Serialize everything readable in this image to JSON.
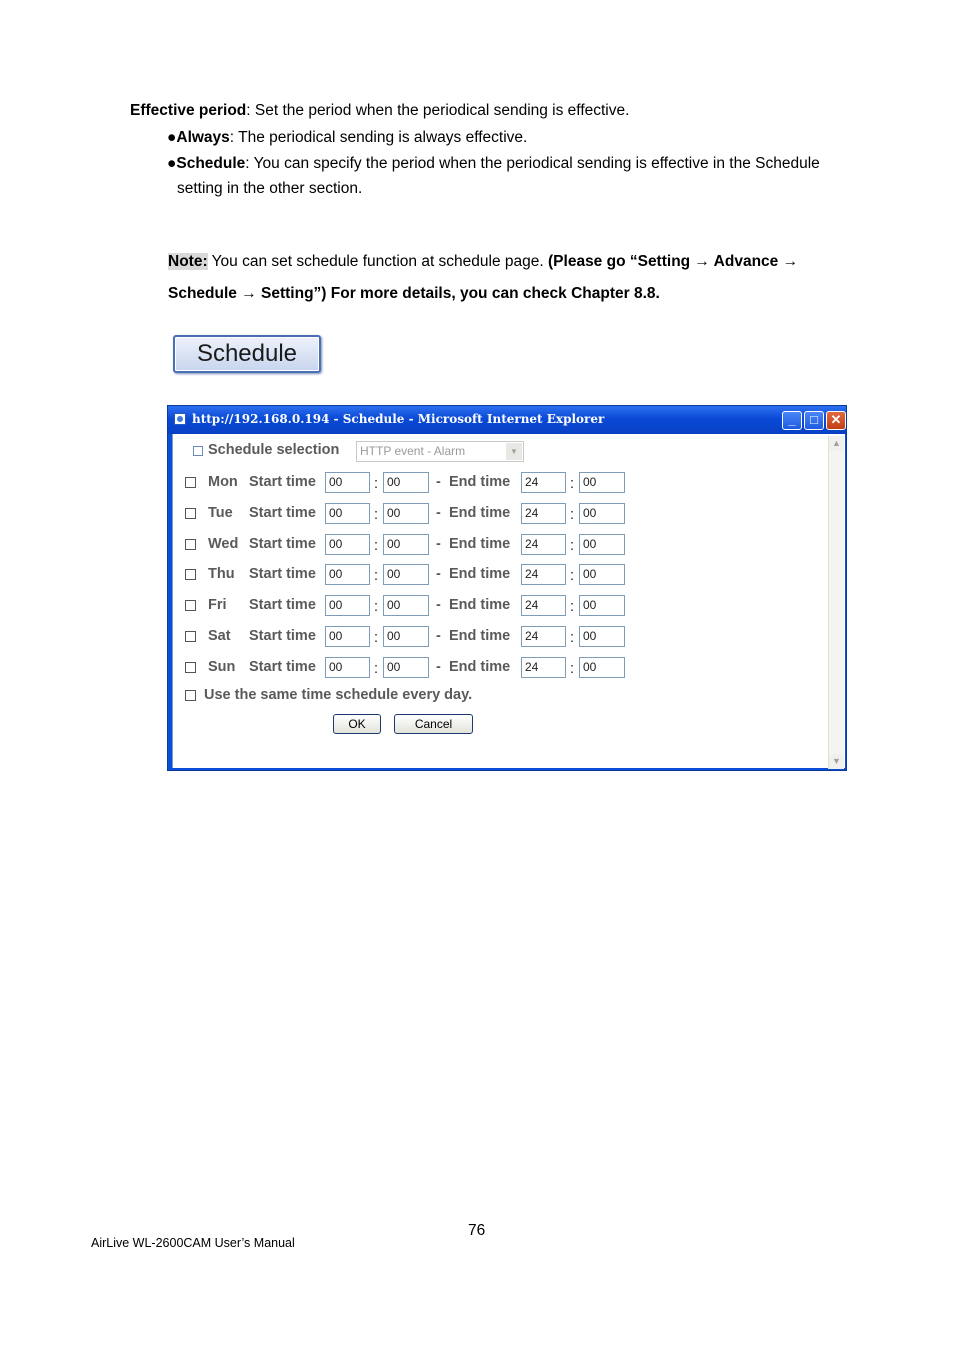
{
  "doc": {
    "p1_bold": "Effective period",
    "p1_text": ": Set the period when the periodical sending is effective.",
    "b1_bullet": "●",
    "b1_bold": "Always",
    "b1_text": ": The periodical sending is always effective.",
    "b2_bullet": "●",
    "b2_bold": "Schedule",
    "b2_text": ": You can specify the period when the periodical sending is effective in the Schedule",
    "b2_cont": "setting in the other section.",
    "note_label": "Note:",
    "note_text": " You can set schedule function at schedule page. ",
    "note_bold1": "(Please go “Setting → Advance →",
    "note_bold2": "Schedule → Setting”) For more details, you can check Chapter 8.8.",
    "schedule_button": "Schedule"
  },
  "window": {
    "title": "http://192.168.0.194 - Schedule - Microsoft Internet Explorer",
    "minimize": "_",
    "maximize": "□",
    "close": "✕",
    "schedule_selection_label": "Schedule selection",
    "schedule_selection_value": "HTTP event - Alarm",
    "start_time_label": "Start time",
    "end_time_label": "End time",
    "colon": ":",
    "dash": "-",
    "days": [
      {
        "day": "Mon",
        "start_h": "00",
        "start_m": "00",
        "end_h": "24",
        "end_m": "00"
      },
      {
        "day": "Tue",
        "start_h": "00",
        "start_m": "00",
        "end_h": "24",
        "end_m": "00"
      },
      {
        "day": "Wed",
        "start_h": "00",
        "start_m": "00",
        "end_h": "24",
        "end_m": "00"
      },
      {
        "day": "Thu",
        "start_h": "00",
        "start_m": "00",
        "end_h": "24",
        "end_m": "00"
      },
      {
        "day": "Fri",
        "start_h": "00",
        "start_m": "00",
        "end_h": "24",
        "end_m": "00"
      },
      {
        "day": "Sat",
        "start_h": "00",
        "start_m": "00",
        "end_h": "24",
        "end_m": "00"
      },
      {
        "day": "Sun",
        "start_h": "00",
        "start_m": "00",
        "end_h": "24",
        "end_m": "00"
      }
    ],
    "same_schedule_label": "Use the same time schedule every day.",
    "ok_label": "OK",
    "cancel_label": "Cancel",
    "scroll_up": "▲",
    "scroll_down": "▼"
  },
  "footer": {
    "page_number": "76",
    "manual": "AirLive WL-2600CAM User’s Manual"
  },
  "colors": {
    "title_bar": "#0a4ad6",
    "input_border": "#7f9db9",
    "label_gray": "#5a5a5a"
  }
}
